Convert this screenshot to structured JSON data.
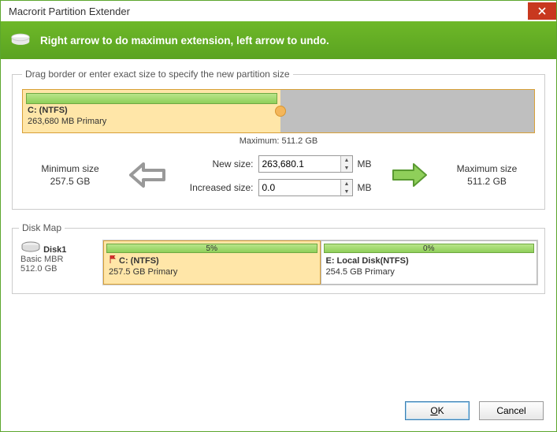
{
  "titlebar": {
    "title": "Macrorit Partition Extender"
  },
  "banner": {
    "text": "Right arrow to do maximun extension, left arrow to undo."
  },
  "sizegroup": {
    "legend": "Drag border or enter exact size to specify the new partition size",
    "partition_name": "C: (NTFS)",
    "partition_info": "263,680 MB Primary",
    "max_label": "Maximum: 511.2 GB",
    "min_title": "Minimum size",
    "min_value": "257.5 GB",
    "max_title": "Maximum size",
    "max_value": "511.2 GB",
    "newsize_label": "New size:",
    "newsize_value": "263,680.1",
    "increased_label": "Increased size:",
    "increased_value": "0.0",
    "unit": "MB"
  },
  "diskmap": {
    "legend": "Disk Map",
    "disk_name": "Disk1",
    "disk_type": "Basic MBR",
    "disk_size": "512.0 GB",
    "parts": [
      {
        "pct": "5%",
        "name": "C: (NTFS)",
        "info": "257.5 GB Primary",
        "active": true,
        "flag": true
      },
      {
        "pct": "0%",
        "name": "E: Local Disk(NTFS)",
        "info": "254.5 GB Primary",
        "active": false,
        "flag": false
      }
    ]
  },
  "buttons": {
    "ok": "OK",
    "cancel": "Cancel"
  }
}
